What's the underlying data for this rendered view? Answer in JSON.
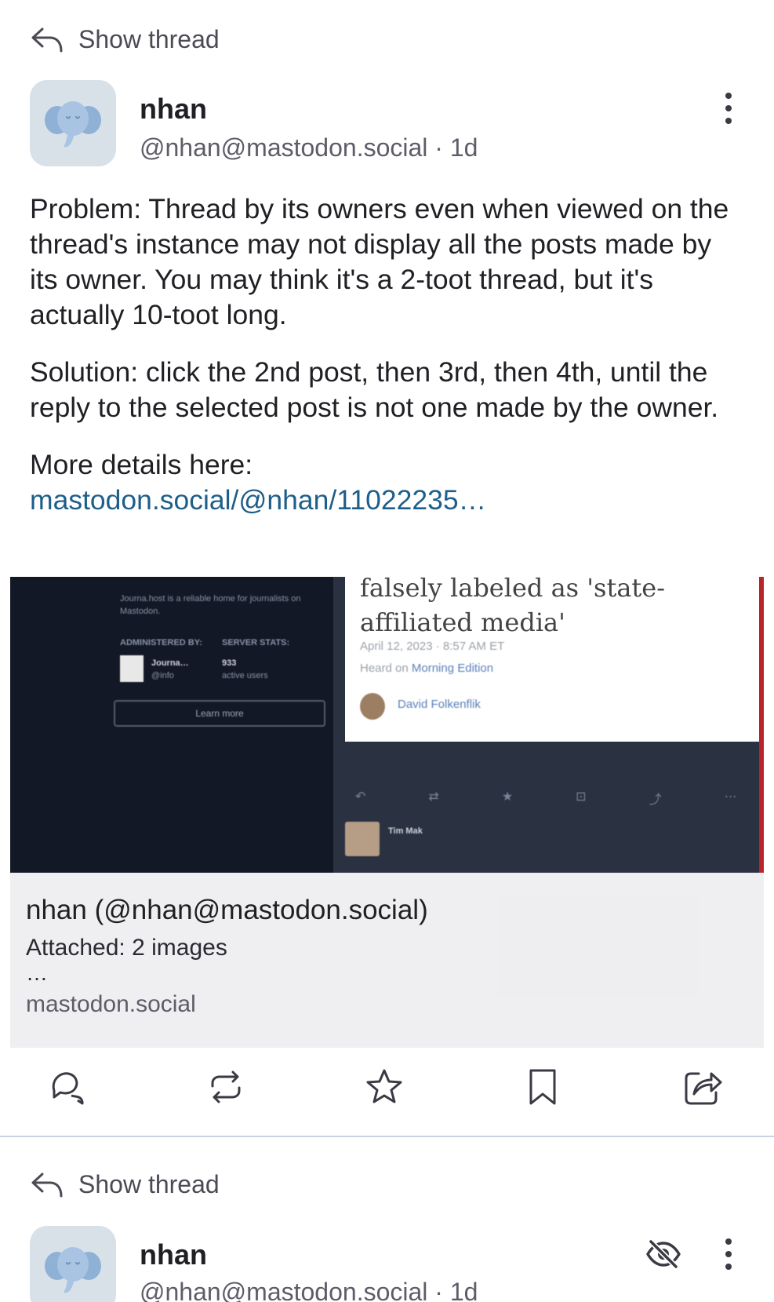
{
  "post1": {
    "show_thread": "Show thread",
    "display_name": "nhan",
    "handle": "@nhan@mastodon.social · 1d",
    "paragraphs": [
      "Problem: Thread by its owners even when viewed on the thread's instance may not display all the posts made by its owner. You may think it's a 2-toot thread, but it's actually 10-toot long.",
      "Solution: click the 2nd post, then 3rd, then 4th, until the reply to the selected post is not one made by the owner."
    ],
    "more_details": "More details here:",
    "link_text": "mastodon.social/@nhan/11022235…",
    "card": {
      "image_headline_line1": "falsely labeled as 'state-",
      "image_headline_line2": "affiliated media'",
      "image_date": "April 12, 2023 · 8:57 AM ET",
      "image_heard_prefix": "Heard on ",
      "image_heard_show": "Morning Edition",
      "image_author": "David Folkenflik",
      "image_admin_label": "ADMINISTERED BY:",
      "image_stats_label": "SERVER STATS:",
      "image_admin_name": "Journa…",
      "image_admin_handle": "@info",
      "image_stats_value": "933",
      "image_stats_unit": "active users",
      "image_learn_more": "Learn more",
      "image_tim": "Tim Mak",
      "title": "nhan (@nhan@mastodon.social)",
      "description": "Attached: 2 images",
      "ellipsis": "…",
      "domain": "mastodon.social"
    },
    "actions": [
      "reply-icon",
      "boost-icon",
      "favourite-icon",
      "bookmark-icon",
      "share-icon"
    ]
  },
  "post2": {
    "show_thread": "Show thread",
    "display_name": "nhan",
    "handle": "@nhan@mastodon.social · 1d"
  },
  "colors": {
    "link": "#1d5e8a",
    "text": "#1f1f24",
    "secondary": "#5d5d69",
    "divider": "#c7d3e2",
    "avatar_bg": "#d9e1e8"
  }
}
